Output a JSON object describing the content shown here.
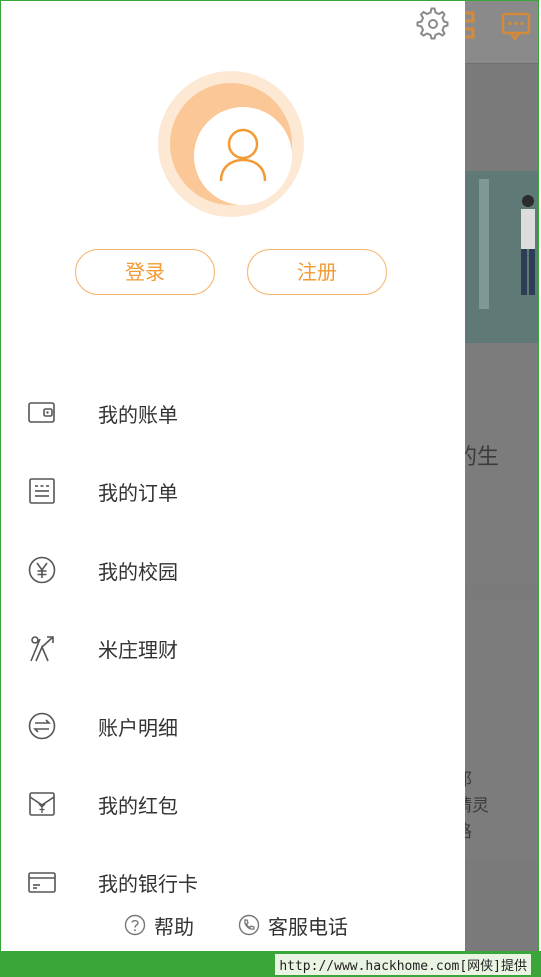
{
  "drawer": {
    "login_label": "登录",
    "register_label": "注册",
    "menu": [
      {
        "label": "我的账单",
        "icon": "wallet-icon"
      },
      {
        "label": "我的订单",
        "icon": "order-icon"
      },
      {
        "label": "我的校园",
        "icon": "yuan-icon"
      },
      {
        "label": "米庄理财",
        "icon": "finance-icon"
      },
      {
        "label": "账户明细",
        "icon": "transfer-icon"
      },
      {
        "label": "我的红包",
        "icon": "red-envelope-icon"
      },
      {
        "label": "我的银行卡",
        "icon": "bank-card-icon"
      }
    ],
    "footer": {
      "help_label": "帮助",
      "service_label": "客服电话"
    }
  },
  "background": {
    "text1": "的生",
    "text2": "邦",
    "text3": "精灵",
    "text4": "路"
  },
  "watermark": "http://www.hackhome.com[网侠]提供",
  "colors": {
    "accent": "#f29a33",
    "text": "#333333",
    "watermark_bar": "#3aa63a"
  }
}
